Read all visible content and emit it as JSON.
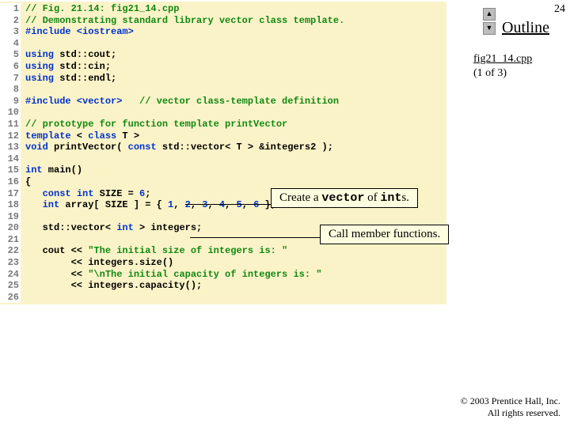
{
  "page_number": "24",
  "outline_label": "Outline",
  "file_info": {
    "name": "fig21_14.cpp",
    "part": "(1 of 3)"
  },
  "callouts": {
    "c1_pre": "Create a ",
    "c1_mono1": "vector",
    "c1_mid": " of ",
    "c1_mono2": "int",
    "c1_post": "s.",
    "c2": "Call member functions."
  },
  "copyright": {
    "l1": "© 2003 Prentice Hall, Inc.",
    "l2": "All rights reserved."
  },
  "code": [
    {
      "n": "1",
      "segs": [
        [
          "comment",
          "// Fig. 21.14: fig21_14.cpp"
        ]
      ]
    },
    {
      "n": "2",
      "segs": [
        [
          "comment",
          "// Demonstrating standard library vector class template."
        ]
      ]
    },
    {
      "n": "3",
      "segs": [
        [
          "pre",
          "#include <iostream>"
        ]
      ]
    },
    {
      "n": "4",
      "segs": []
    },
    {
      "n": "5",
      "segs": [
        [
          "kw",
          "using"
        ],
        [
          "plain",
          " std::cout;"
        ]
      ]
    },
    {
      "n": "6",
      "segs": [
        [
          "kw",
          "using"
        ],
        [
          "plain",
          " std::cin;"
        ]
      ]
    },
    {
      "n": "7",
      "segs": [
        [
          "kw",
          "using"
        ],
        [
          "plain",
          " std::endl;"
        ]
      ]
    },
    {
      "n": "8",
      "segs": []
    },
    {
      "n": "9",
      "segs": [
        [
          "pre",
          "#include <vector>"
        ],
        [
          "plain",
          "   "
        ],
        [
          "comment",
          "// vector class-template definition"
        ]
      ]
    },
    {
      "n": "10",
      "segs": []
    },
    {
      "n": "11",
      "segs": [
        [
          "comment",
          "// prototype for function template printVector"
        ]
      ]
    },
    {
      "n": "12",
      "segs": [
        [
          "kw",
          "template"
        ],
        [
          "plain",
          " < "
        ],
        [
          "kw",
          "class"
        ],
        [
          "plain",
          " T >"
        ]
      ]
    },
    {
      "n": "13",
      "segs": [
        [
          "kw",
          "void"
        ],
        [
          "plain",
          " printVector( "
        ],
        [
          "kw",
          "const"
        ],
        [
          "plain",
          " std::vector< T > &integers2 );"
        ]
      ]
    },
    {
      "n": "14",
      "segs": []
    },
    {
      "n": "15",
      "segs": [
        [
          "kw",
          "int"
        ],
        [
          "plain",
          " main()"
        ]
      ]
    },
    {
      "n": "16",
      "segs": [
        [
          "plain",
          "{"
        ]
      ]
    },
    {
      "n": "17",
      "segs": [
        [
          "plain",
          "   "
        ],
        [
          "kw",
          "const int"
        ],
        [
          "plain",
          " SIZE = "
        ],
        [
          "kw",
          "6"
        ],
        [
          "plain",
          ";"
        ]
      ]
    },
    {
      "n": "18",
      "segs": [
        [
          "plain",
          "   "
        ],
        [
          "kw",
          "int"
        ],
        [
          "plain",
          " array[ SIZE ] = { "
        ],
        [
          "kw",
          "1"
        ],
        [
          "plain",
          ", "
        ],
        [
          "kw",
          "2"
        ],
        [
          "plain",
          ", "
        ],
        [
          "kw",
          "3"
        ],
        [
          "plain",
          ", "
        ],
        [
          "kw",
          "4"
        ],
        [
          "plain",
          ", "
        ],
        [
          "kw",
          "5"
        ],
        [
          "plain",
          ", "
        ],
        [
          "kw",
          "6"
        ],
        [
          "plain",
          " };"
        ]
      ]
    },
    {
      "n": "19",
      "segs": []
    },
    {
      "n": "20",
      "segs": [
        [
          "plain",
          "   std::vector< "
        ],
        [
          "kw",
          "int"
        ],
        [
          "plain",
          " > integers;"
        ]
      ]
    },
    {
      "n": "21",
      "segs": []
    },
    {
      "n": "22",
      "segs": [
        [
          "plain",
          "   cout << "
        ],
        [
          "str",
          "\"The initial size of integers is: \""
        ]
      ]
    },
    {
      "n": "23",
      "segs": [
        [
          "plain",
          "        << integers.size()"
        ]
      ]
    },
    {
      "n": "24",
      "segs": [
        [
          "plain",
          "        << "
        ],
        [
          "str",
          "\"\\nThe initial capacity of integers is: \""
        ]
      ]
    },
    {
      "n": "25",
      "segs": [
        [
          "plain",
          "        << integers.capacity();"
        ]
      ]
    },
    {
      "n": "26",
      "segs": []
    }
  ]
}
